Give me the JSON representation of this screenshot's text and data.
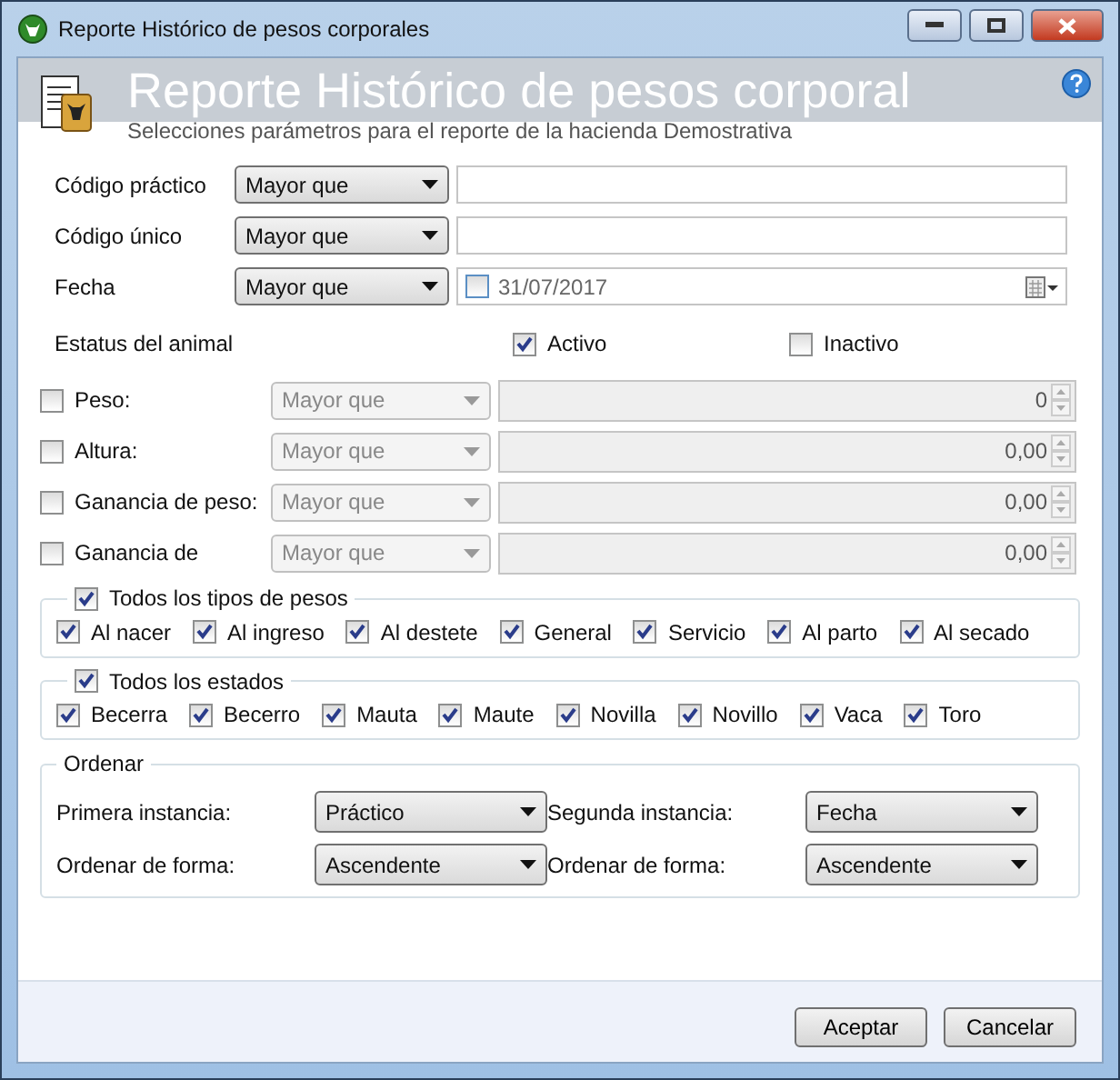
{
  "window": {
    "title": "Reporte Histórico de pesos corporales"
  },
  "header": {
    "title": "Reporte Histórico de pesos corporal",
    "subtitle": "Selecciones parámetros para el reporte de la hacienda Demostrativa"
  },
  "filters": [
    {
      "kind": "text",
      "label": "Código práctico",
      "operator": "Mayor que"
    },
    {
      "kind": "text",
      "label": "Código único",
      "operator": "Mayor que"
    },
    {
      "kind": "date",
      "label": "Fecha",
      "operator": "Mayor que",
      "date": "31/07/2017",
      "checked": false
    }
  ],
  "status": {
    "label": "Estatus del animal",
    "options": [
      {
        "label": "Activo",
        "checked": true
      },
      {
        "label": "Inactivo",
        "checked": false
      }
    ]
  },
  "numeric_filters": [
    {
      "label": "Peso:",
      "checked": false,
      "operator": "Mayor que",
      "value": "0"
    },
    {
      "label": "Altura:",
      "checked": false,
      "operator": "Mayor que",
      "value": "0,00"
    },
    {
      "label": "Ganancia de peso:",
      "checked": false,
      "operator": "Mayor que",
      "value": "0,00"
    },
    {
      "label": "Ganancia de",
      "checked": false,
      "operator": "Mayor que",
      "value": "0,00"
    }
  ],
  "groups": [
    {
      "title": "Todos los tipos de pesos",
      "checked": true,
      "options": [
        {
          "label": "Al nacer",
          "checked": true
        },
        {
          "label": "Al ingreso",
          "checked": true
        },
        {
          "label": "Al destete",
          "checked": true
        },
        {
          "label": "General",
          "checked": true
        },
        {
          "label": "Servicio",
          "checked": true
        },
        {
          "label": "Al parto",
          "checked": true
        },
        {
          "label": "Al secado",
          "checked": true
        }
      ]
    },
    {
      "title": "Todos los estados",
      "checked": true,
      "options": [
        {
          "label": "Becerra",
          "checked": true
        },
        {
          "label": "Becerro",
          "checked": true
        },
        {
          "label": "Mauta",
          "checked": true
        },
        {
          "label": "Maute",
          "checked": true
        },
        {
          "label": "Novilla",
          "checked": true
        },
        {
          "label": "Novillo",
          "checked": true
        },
        {
          "label": "Vaca",
          "checked": true
        },
        {
          "label": "Toro",
          "checked": true
        }
      ]
    }
  ],
  "order": {
    "title": "Ordenar",
    "fields": [
      {
        "label": "Primera instancia:",
        "value": "Práctico"
      },
      {
        "label": "Segunda instancia:",
        "value": "Fecha"
      },
      {
        "label": "Ordenar de forma:",
        "value": "Ascendente"
      },
      {
        "label": "Ordenar de forma:",
        "value": "Ascendente"
      }
    ]
  },
  "buttons": [
    "Aceptar",
    "Cancelar"
  ]
}
